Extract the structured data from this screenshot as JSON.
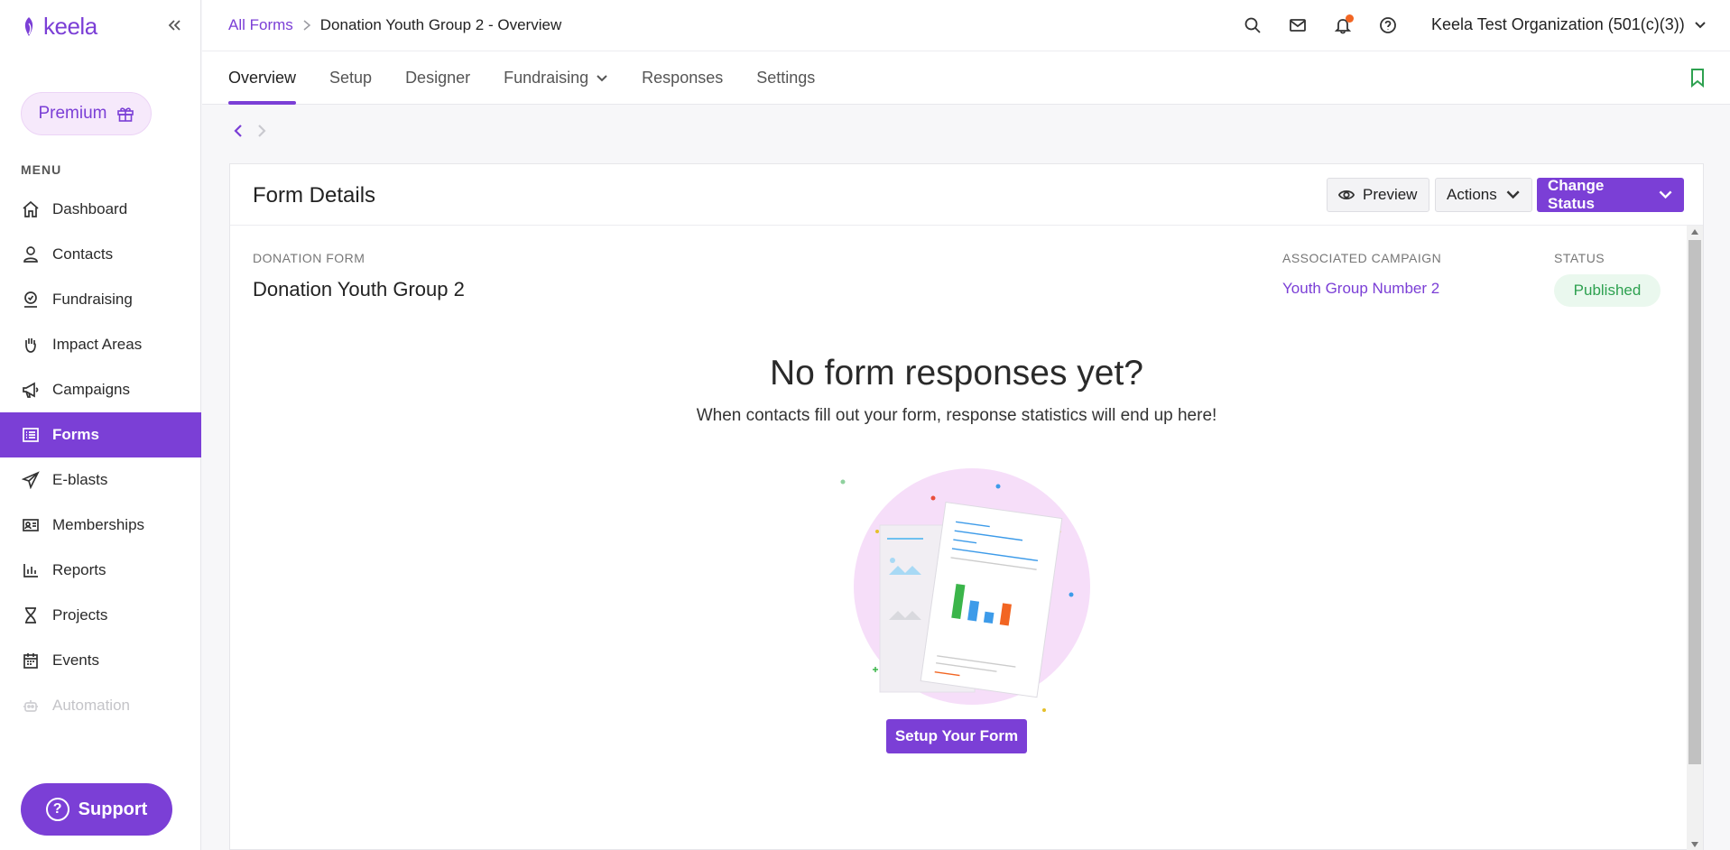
{
  "brand": {
    "name": "keela",
    "accent": "#7b3fd6"
  },
  "sidebar": {
    "collapse_icon": "double-chevron-left-icon",
    "premium_label": "Premium",
    "menu_label": "MENU",
    "items": [
      {
        "label": "Dashboard",
        "icon": "home-icon"
      },
      {
        "label": "Contacts",
        "icon": "person-icon"
      },
      {
        "label": "Fundraising",
        "icon": "donation-icon"
      },
      {
        "label": "Impact Areas",
        "icon": "hand-icon"
      },
      {
        "label": "Campaigns",
        "icon": "megaphone-icon"
      },
      {
        "label": "Forms",
        "icon": "list-icon",
        "active": true
      },
      {
        "label": "E-blasts",
        "icon": "paper-plane-icon"
      },
      {
        "label": "Memberships",
        "icon": "id-card-icon"
      },
      {
        "label": "Reports",
        "icon": "bar-chart-icon"
      },
      {
        "label": "Projects",
        "icon": "hourglass-icon"
      },
      {
        "label": "Events",
        "icon": "calendar-icon"
      },
      {
        "label": "Automation",
        "icon": "robot-icon",
        "disabled": true
      }
    ],
    "support_label": "Support"
  },
  "header": {
    "breadcrumb": {
      "link": "All Forms",
      "current": "Donation Youth Group 2 - Overview"
    },
    "org_name": "Keela Test Organization (501(c)(3))"
  },
  "tabs": [
    {
      "label": "Overview",
      "active": true
    },
    {
      "label": "Setup"
    },
    {
      "label": "Designer"
    },
    {
      "label": "Fundraising",
      "dropdown": true
    },
    {
      "label": "Responses"
    },
    {
      "label": "Settings"
    }
  ],
  "card": {
    "title": "Form Details",
    "preview_label": "Preview",
    "actions_label": "Actions",
    "change_status_label": "Change Status",
    "donation_form_label": "DONATION FORM",
    "form_name": "Donation Youth Group 2",
    "campaign_label": "ASSOCIATED CAMPAIGN",
    "campaign_name": "Youth Group Number 2",
    "status_label": "STATUS",
    "status_value": "Published",
    "empty_title": "No form responses yet?",
    "empty_text": "When contacts fill out your form, response statistics will end up here!",
    "setup_button": "Setup Your Form"
  }
}
